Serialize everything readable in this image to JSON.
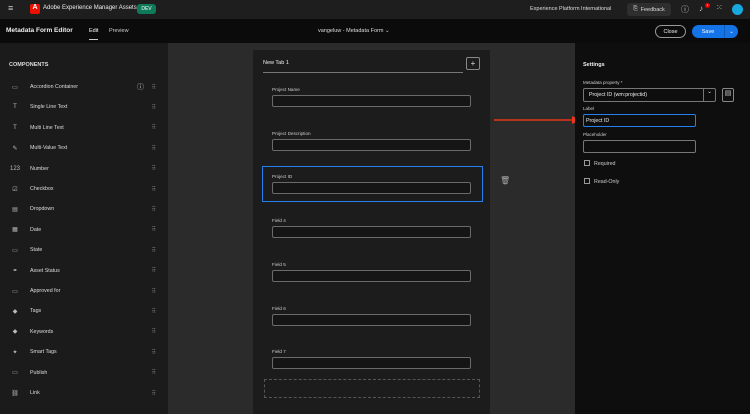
{
  "header": {
    "app_name": "Adobe Experience Manager Assets",
    "env_badge": "DEV",
    "org": "Experience Platform International",
    "feedback": "Feedback",
    "notifications": "1"
  },
  "subheader": {
    "title": "Metadata Form Editor",
    "tabs": [
      "Edit",
      "Preview"
    ],
    "form_name": "vangeluw - Metadata Form",
    "close": "Close",
    "save": "Save"
  },
  "components": {
    "heading": "COMPONENTS",
    "items": [
      {
        "label": "Accordion Container",
        "icon": "▭"
      },
      {
        "label": "Single Line Text",
        "icon": "T"
      },
      {
        "label": "Multi Line Text",
        "icon": "T"
      },
      {
        "label": "Multi-Value Text",
        "icon": "✎"
      },
      {
        "label": "Number",
        "icon": "123"
      },
      {
        "label": "Checkbox",
        "icon": "☑"
      },
      {
        "label": "Dropdown",
        "icon": "▤"
      },
      {
        "label": "Date",
        "icon": "▦"
      },
      {
        "label": "State",
        "icon": "▭"
      },
      {
        "label": "Asset Status",
        "icon": "⚭"
      },
      {
        "label": "Approved for",
        "icon": "▭"
      },
      {
        "label": "Tags",
        "icon": "◆"
      },
      {
        "label": "Keywords",
        "icon": "◆"
      },
      {
        "label": "Smart Tags",
        "icon": "✦"
      },
      {
        "label": "Publish",
        "icon": "▭"
      },
      {
        "label": "Link",
        "icon": "⛓"
      }
    ]
  },
  "form": {
    "tab": "New Tab 1",
    "fields": [
      "Project Name",
      "Project Description",
      "Project ID",
      "Field 4",
      "Field 5",
      "Field 6",
      "Field 7"
    ]
  },
  "settings": {
    "heading": "Settings",
    "metadata_property_label": "Metadata property",
    "metadata_property_value": "Project ID (wm:projectid)",
    "label_label": "Label",
    "label_value": "Project ID",
    "placeholder_label": "Placeholder",
    "placeholder_value": "",
    "required": "Required",
    "readonly": "Read-Only"
  }
}
